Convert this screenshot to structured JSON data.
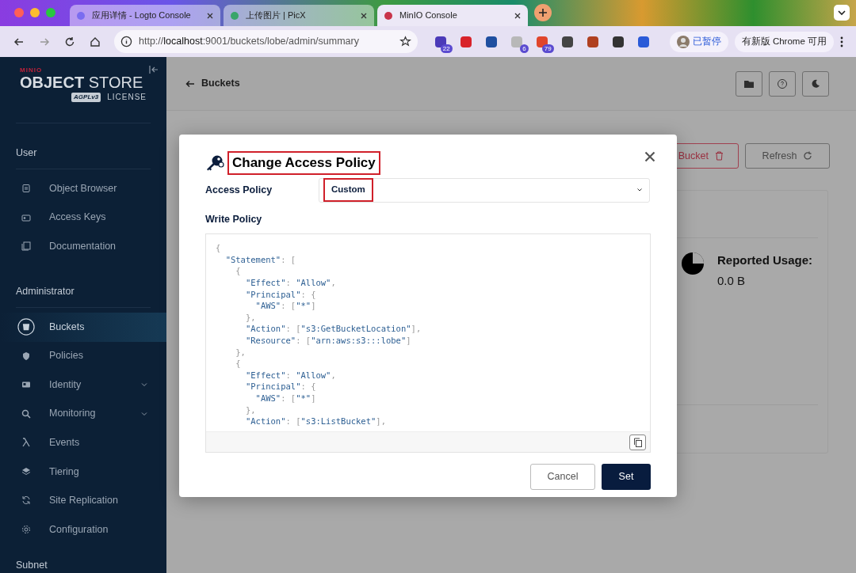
{
  "browser": {
    "tabs": [
      {
        "title": "应用详情 - Logto Console",
        "selected": false
      },
      {
        "title": "上传图片 | PicX",
        "selected": false
      },
      {
        "title": "MinIO Console",
        "selected": true
      }
    ],
    "address": {
      "scheme": "http://",
      "host": "localhost",
      "rest": ":9001/buckets/lobe/admin/summary"
    },
    "extension_badges": [
      "22",
      "6",
      "79"
    ],
    "profile": "已暂停",
    "update": "有新版 Chrome 可用"
  },
  "sidebar": {
    "logo": {
      "brand": "MINIO",
      "product_bold": "OBJECT",
      "product": "STORE",
      "license_mark": "AGPLv3",
      "license": "LICENSE"
    },
    "sections": [
      {
        "title": "User",
        "items": [
          {
            "label": "Object Browser",
            "selected": false,
            "expandable": false
          },
          {
            "label": "Access Keys",
            "selected": false,
            "expandable": false
          },
          {
            "label": "Documentation",
            "selected": false,
            "expandable": false
          }
        ]
      },
      {
        "title": "Administrator",
        "items": [
          {
            "label": "Buckets",
            "selected": true,
            "expandable": false
          },
          {
            "label": "Policies",
            "selected": false,
            "expandable": false
          },
          {
            "label": "Identity",
            "selected": false,
            "expandable": true
          },
          {
            "label": "Monitoring",
            "selected": false,
            "expandable": true
          },
          {
            "label": "Events",
            "selected": false,
            "expandable": false
          },
          {
            "label": "Tiering",
            "selected": false,
            "expandable": false
          },
          {
            "label": "Site Replication",
            "selected": false,
            "expandable": false
          },
          {
            "label": "Configuration",
            "selected": false,
            "expandable": false
          }
        ]
      },
      {
        "title": "Subnet"
      }
    ]
  },
  "header": {
    "back_label": "Buckets"
  },
  "page": {
    "delete_button": "Bucket",
    "refresh_button": "Refresh",
    "usage_label": "Reported Usage:",
    "usage_value": "0.0 B"
  },
  "modal": {
    "title": "Change Access Policy",
    "access_policy_label": "Access Policy",
    "access_policy_value": "Custom",
    "write_policy_label": "Write Policy",
    "code_lines": [
      "{",
      "  \"Statement\": [",
      "    {",
      "      \"Effect\": \"Allow\",",
      "      \"Principal\": {",
      "        \"AWS\": [\"*\"]",
      "      },",
      "      \"Action\": [\"s3:GetBucketLocation\"],",
      "      \"Resource\": [\"arn:aws:s3:::lobe\"]",
      "    },",
      "    {",
      "      \"Effect\": \"Allow\",",
      "      \"Principal\": {",
      "        \"AWS\": [\"*\"]",
      "      },",
      "      \"Action\": [\"s3:ListBucket\"],"
    ],
    "cancel": "Cancel",
    "submit": "Set"
  }
}
